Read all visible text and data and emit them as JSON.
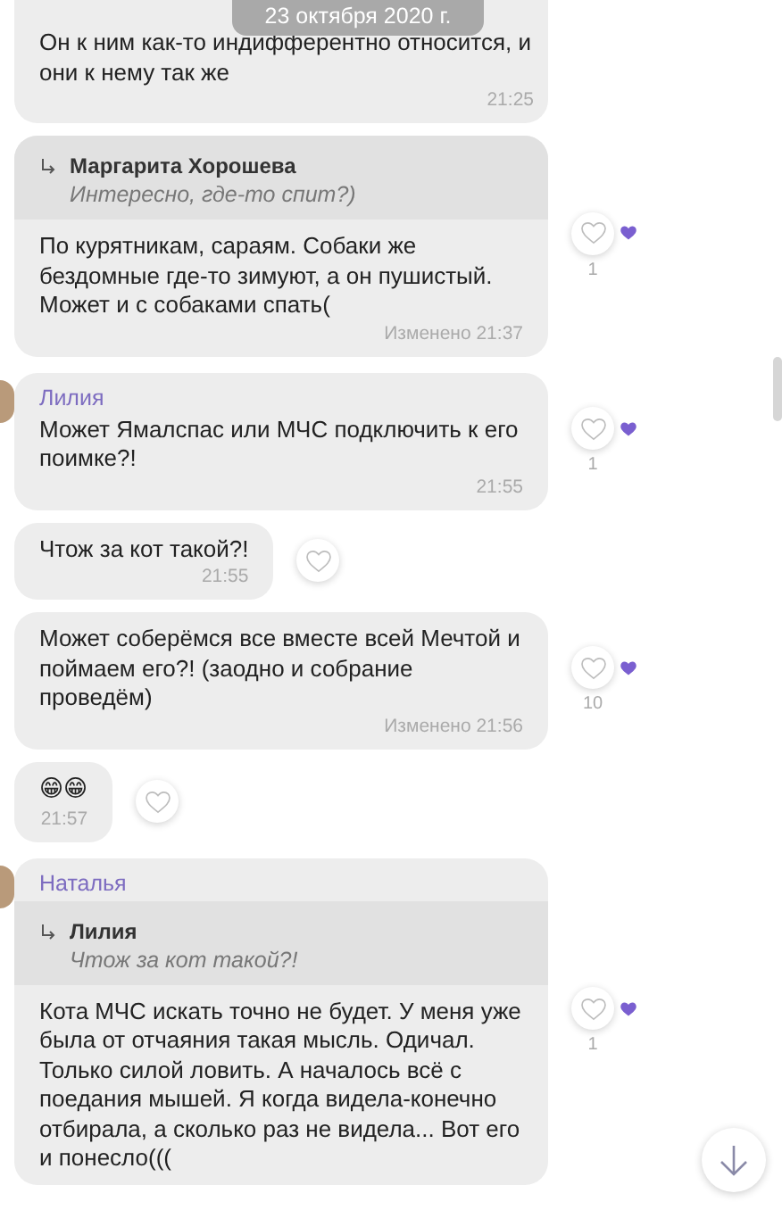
{
  "date_label": "23 октября 2020 г.",
  "messages": [
    {
      "kind": "text",
      "text": "Он к ним как-то индифферентно относится, и они к нему так же",
      "time": "21:25"
    },
    {
      "kind": "text",
      "reply": {
        "author": "Маргарита Хорошева",
        "text": "Интересно, где-то спит?)"
      },
      "text": "По курятникам, сараям. Собаки же бездомные где-то зимуют, а он пушистый. Может и с собаками спать(",
      "time": "Изменено 21:37",
      "like": true,
      "reaction_count": "1"
    },
    {
      "kind": "text",
      "sender": "Лилия",
      "text": "Может Ямалспас или МЧС подключить к его поимке?!",
      "time": "21:55",
      "like": true,
      "reaction_count": "1"
    },
    {
      "kind": "text",
      "text": "Чтож за кот такой?!",
      "time": "21:55",
      "like": true
    },
    {
      "kind": "text",
      "text": "Может соберёмся все вместе всей Мечтой и поймаем его?! (заодно и собрание проведём)",
      "time": "Изменено 21:56",
      "like": true,
      "reaction_count": "10"
    },
    {
      "kind": "emoji",
      "text": "😁😁",
      "time": "21:57",
      "like": true
    },
    {
      "kind": "text",
      "sender": "Наталья",
      "reply": {
        "author": "Лилия",
        "text": "Чтож за кот такой?!"
      },
      "text": "Кота МЧС искать точно не будет. У меня уже была от отчаяния такая мысль. Одичал. Только силой ловить. А началось всё с поедания мышей. Я когда видела-конечно отбирала, а сколько раз не видела... Вот его и понесло(((",
      "like": true,
      "reaction_count": "1"
    }
  ]
}
